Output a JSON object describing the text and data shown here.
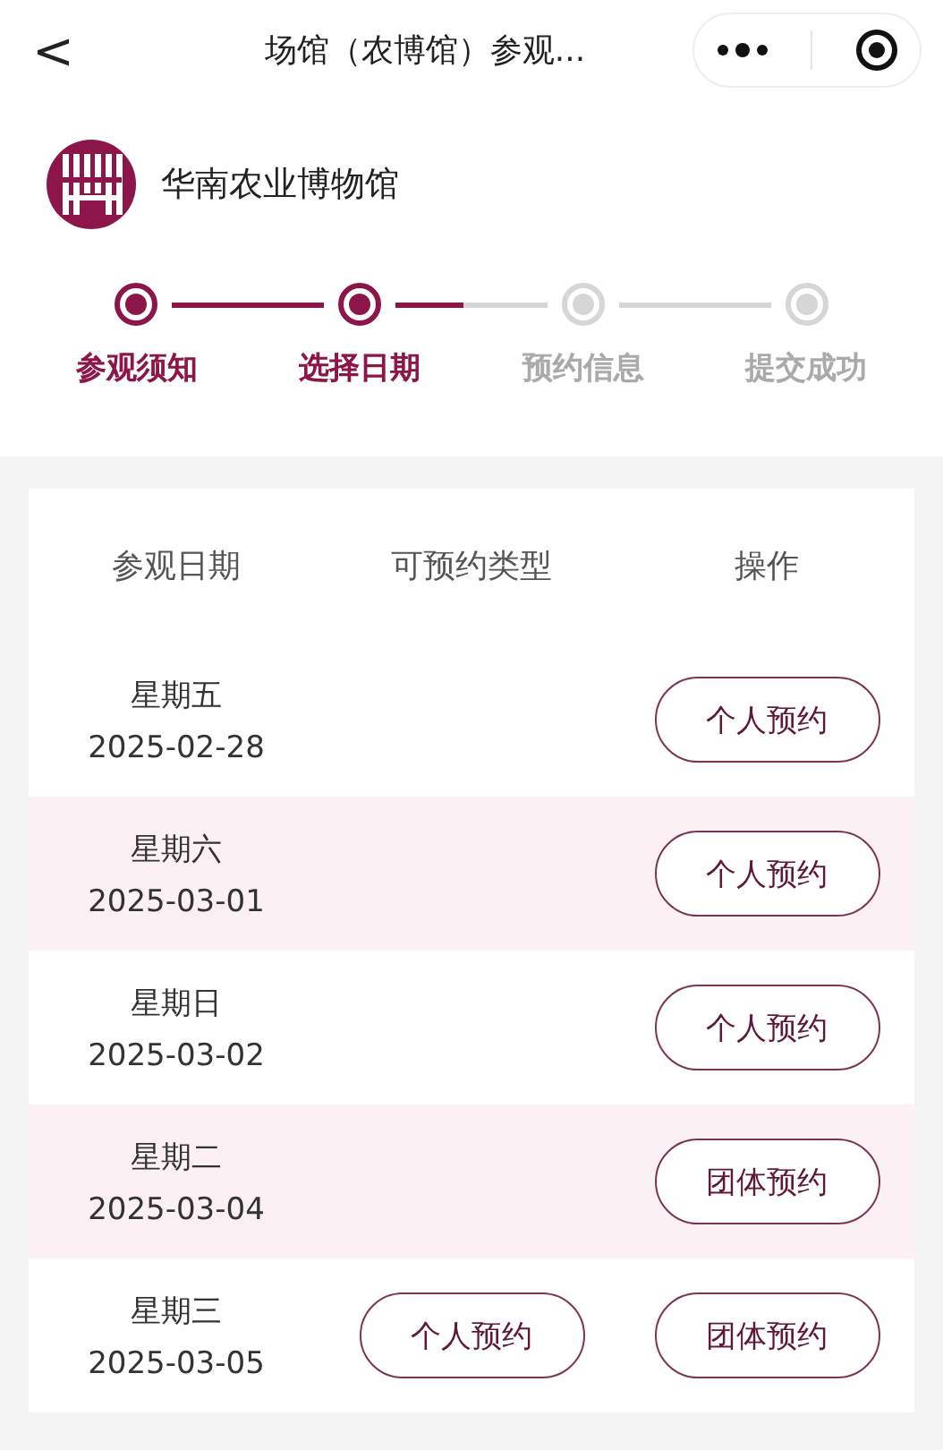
{
  "nav_bar": {
    "back": "<",
    "title": "场馆（农博馆）参观..."
  },
  "museum": {
    "name": "华南农业博物馆"
  },
  "steps": [
    {
      "label": "参观须知",
      "active": true
    },
    {
      "label": "选择日期",
      "active": true
    },
    {
      "label": "预约信息",
      "active": false
    },
    {
      "label": "提交成功",
      "active": false
    }
  ],
  "table": {
    "columns": [
      "参观日期",
      "可预约类型",
      "操作"
    ],
    "rows": [
      {
        "weekday": "星期五",
        "date": "2025-02-28",
        "types": [],
        "actions": [
          "个人预约"
        ]
      },
      {
        "weekday": "星期六",
        "date": "2025-03-01",
        "types": [],
        "actions": [
          "个人预约"
        ]
      },
      {
        "weekday": "星期日",
        "date": "2025-03-02",
        "types": [],
        "actions": [
          "个人预约"
        ]
      },
      {
        "weekday": "星期二",
        "date": "2025-03-04",
        "types": [],
        "actions": [
          "团体预约"
        ]
      },
      {
        "weekday": "星期三",
        "date": "2025-03-05",
        "types": [
          "个人预约"
        ],
        "actions": [
          "团体预约"
        ]
      }
    ]
  }
}
